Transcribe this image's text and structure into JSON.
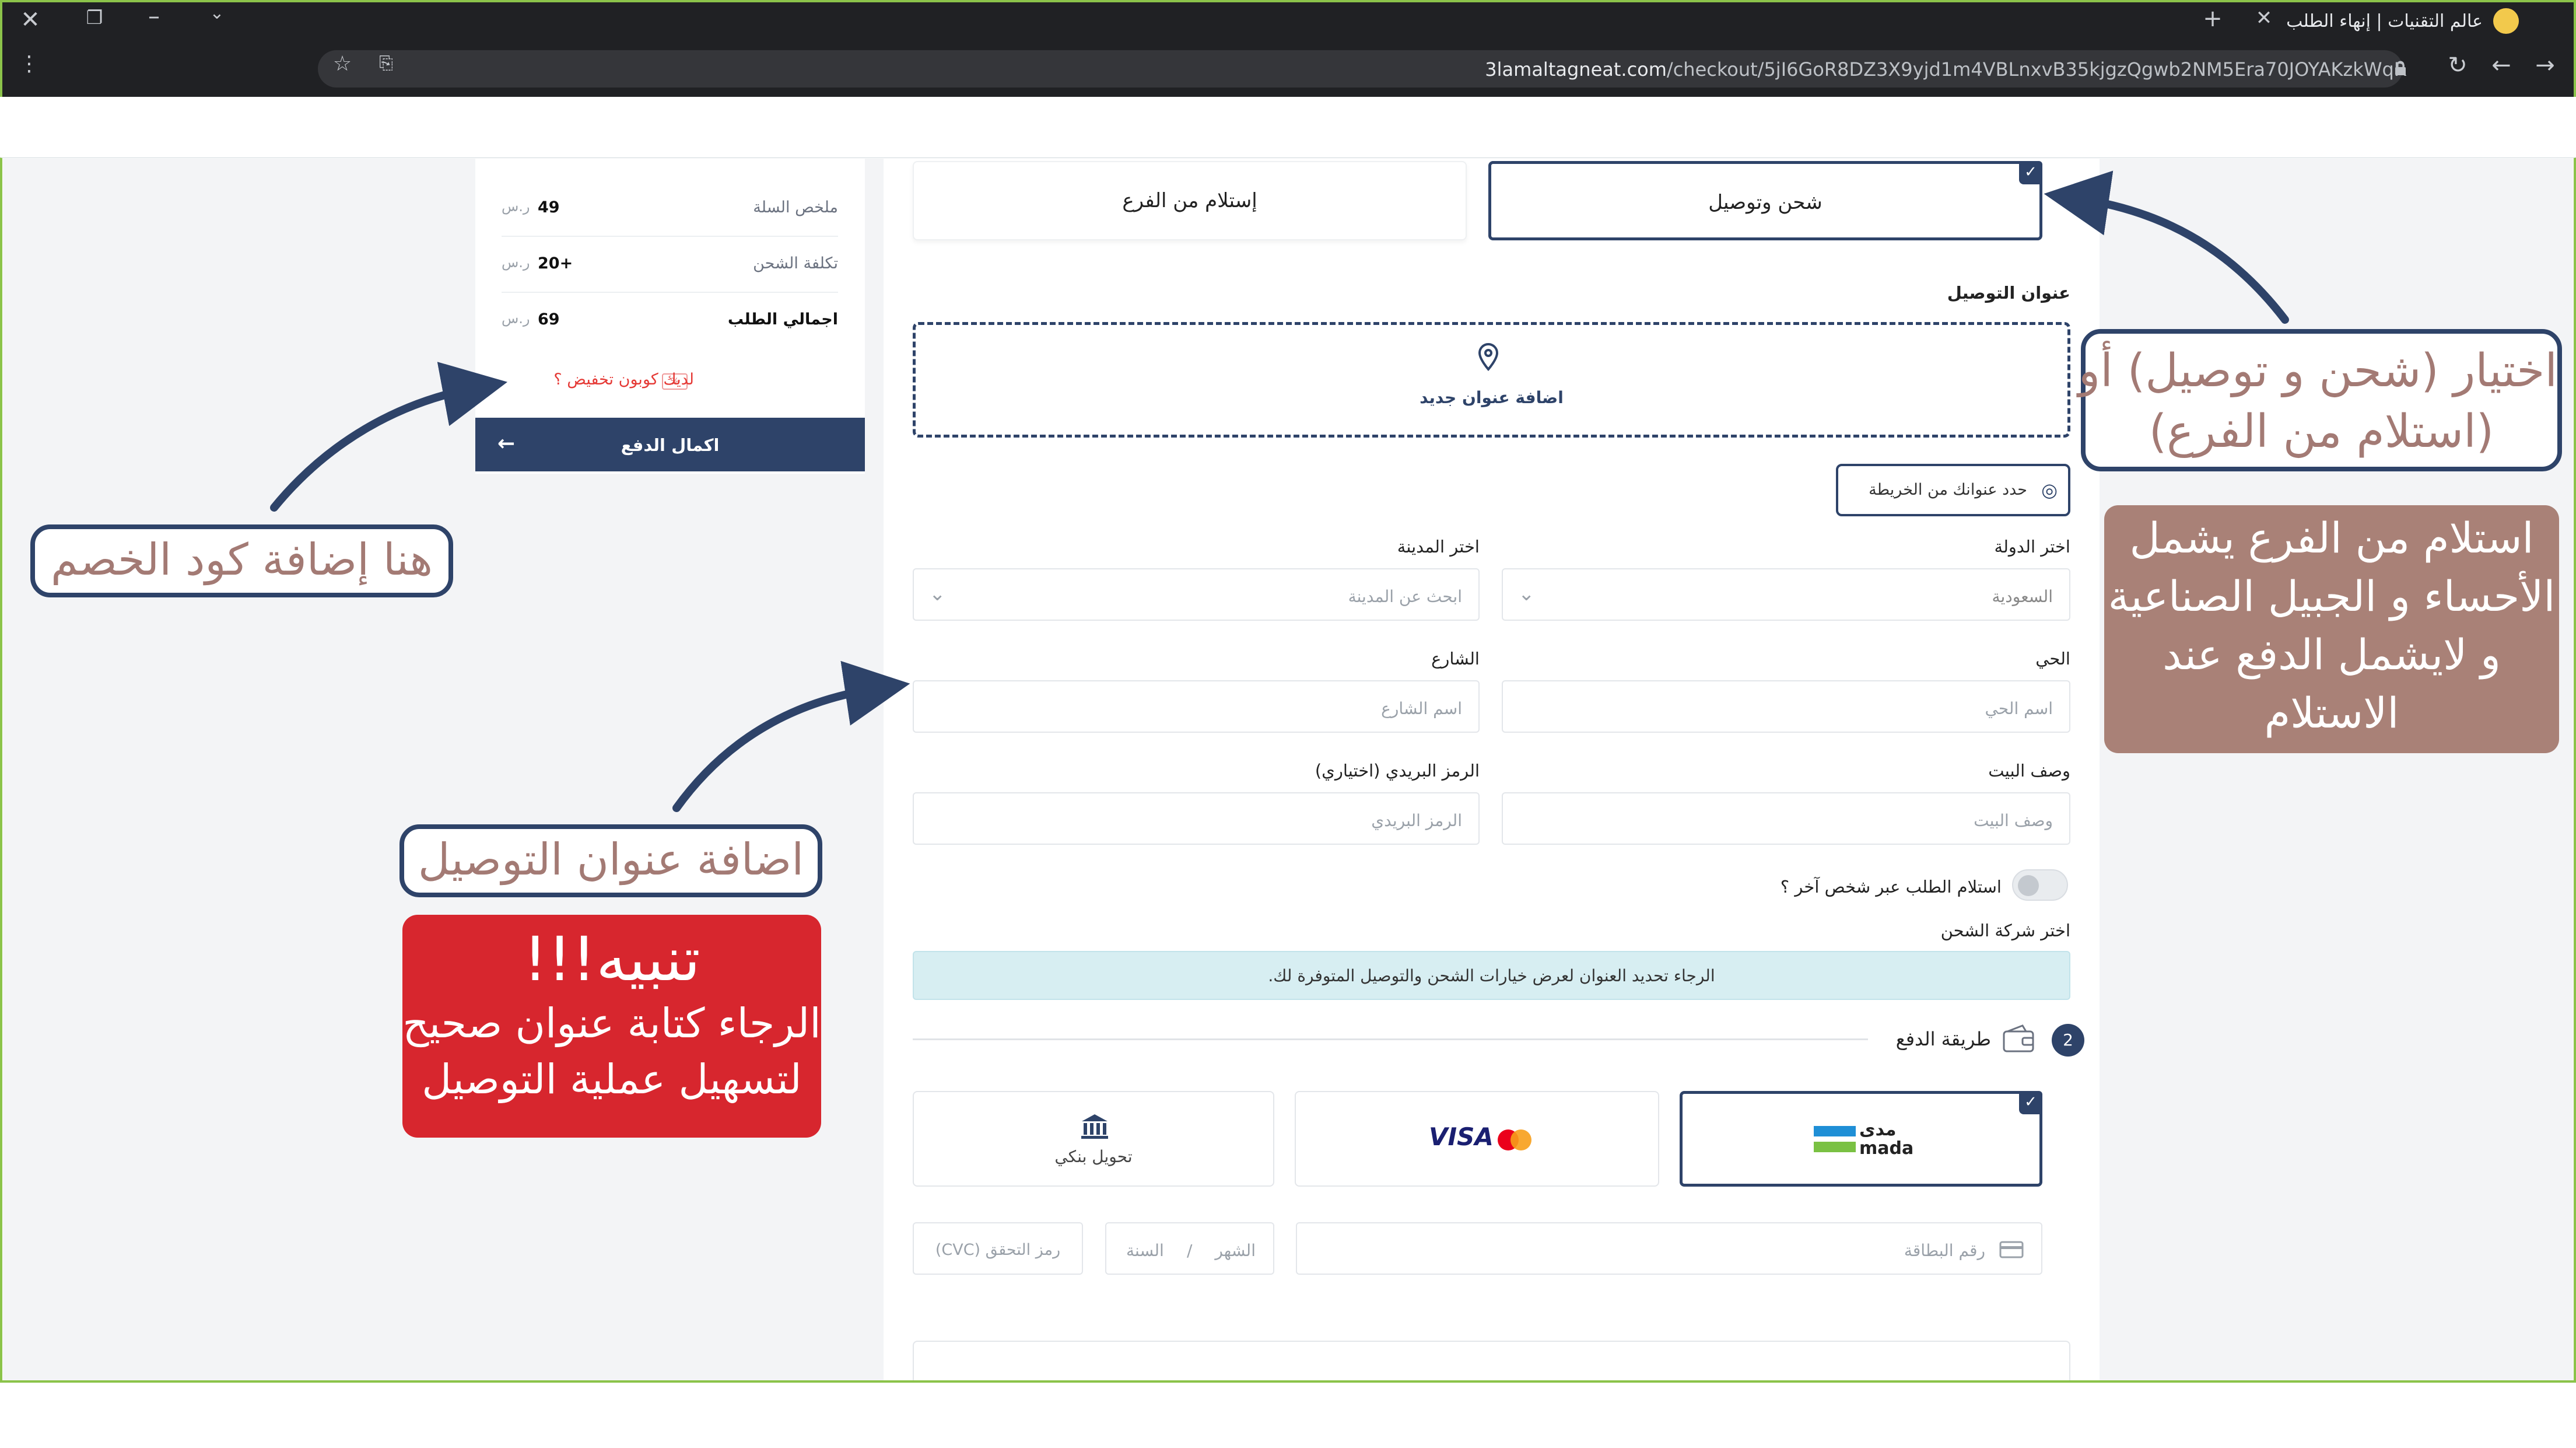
{
  "browser": {
    "tab_title": "عالم التقنيات | إنهاء الطلب",
    "url_domain": "3lamaltagneat.com",
    "url_path": "/checkout/5jI6GoR8DZ3X9yjd1m4VBLnxvB35kjgzQgwb2NM5Era70JOYAKzkWqR"
  },
  "summary": {
    "rows": [
      {
        "label": "ملخص السلة",
        "value": "49",
        "currency": "ر.س"
      },
      {
        "label": "تكلفة الشحن",
        "value": "+20",
        "currency": "ر.س"
      },
      {
        "label": "اجمالي الطلب",
        "value": "69",
        "currency": "ر.س"
      }
    ],
    "coupon_text": "لديك كوبون تخفيض ؟",
    "pay_button": "اكمال الدفع"
  },
  "delivery": {
    "ship_option": "شحن وتوصيل",
    "pickup_option": "إستلام من الفرع",
    "address_title": "عنوان التوصيل",
    "add_address": "اضافة عنوان جديد",
    "map_button": "حدد عنوانك من الخريطة",
    "country_label": "اختر الدولة",
    "country_value": "السعودية",
    "city_label": "اختر المدينة",
    "city_placeholder": "ابحث عن المدينة",
    "district_label": "الحي",
    "district_placeholder": "اسم الحي",
    "street_label": "الشارع",
    "street_placeholder": "اسم الشارع",
    "house_label": "وصف البيت",
    "house_placeholder": "وصف البيت",
    "postal_label": "الرمز البريدي (اختياري)",
    "postal_placeholder": "الرمز البريدي",
    "other_person": "استلام الطلب عبر شخص آخر ؟",
    "shipping_company_label": "اختر شركة الشحن",
    "info_message": "الرجاء تحديد العنوان لعرض خيارات الشحن والتوصيل المتوفرة لك."
  },
  "payment": {
    "step": "2",
    "title": "طريقة الدفع",
    "mada_ar": "مدى",
    "mada_en": "mada",
    "visa": "VISA",
    "bank": "تحويل بنكي",
    "card_number": "رقم البطاقة",
    "month": "الشهر",
    "slash": "/",
    "year": "السنة",
    "cvc": "(CVC) رمز التحقق"
  },
  "annotations": {
    "ship_choice_line1": "اختيار (شحن و توصيل) أو",
    "ship_choice_line2": "(استلام من الفرع)",
    "branch_line1": "استلام من الفرع يشمل",
    "branch_line2": "الأحساء و الجبيل الصناعية",
    "branch_line3": "و لايشمل الدفع عند",
    "branch_line4": "الاستلام",
    "coupon_hint": "هنا إضافة كود الخصم",
    "address_hint": "اضافة عنوان التوصيل",
    "warning_title": "تنبيه!!!",
    "warning_line1": "الرجاء كتابة عنوان صحيح",
    "warning_line2": "لتسهيل عملية التوصيل"
  },
  "colors": {
    "navy": "#2e4369",
    "accent_mauve": "#a98177",
    "warning_red": "#d7262e",
    "info_bg": "#d7eef2"
  }
}
